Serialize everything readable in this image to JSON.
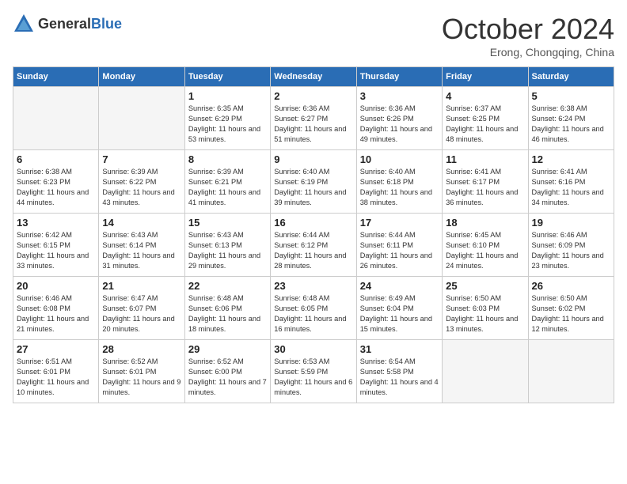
{
  "header": {
    "logo_general": "General",
    "logo_blue": "Blue",
    "month": "October 2024",
    "location": "Erong, Chongqing, China"
  },
  "weekdays": [
    "Sunday",
    "Monday",
    "Tuesday",
    "Wednesday",
    "Thursday",
    "Friday",
    "Saturday"
  ],
  "weeks": [
    [
      {
        "day": "",
        "sunrise": "",
        "sunset": "",
        "daylight": "",
        "empty": true
      },
      {
        "day": "",
        "sunrise": "",
        "sunset": "",
        "daylight": "",
        "empty": true
      },
      {
        "day": "1",
        "sunrise": "Sunrise: 6:35 AM",
        "sunset": "Sunset: 6:29 PM",
        "daylight": "Daylight: 11 hours and 53 minutes."
      },
      {
        "day": "2",
        "sunrise": "Sunrise: 6:36 AM",
        "sunset": "Sunset: 6:27 PM",
        "daylight": "Daylight: 11 hours and 51 minutes."
      },
      {
        "day": "3",
        "sunrise": "Sunrise: 6:36 AM",
        "sunset": "Sunset: 6:26 PM",
        "daylight": "Daylight: 11 hours and 49 minutes."
      },
      {
        "day": "4",
        "sunrise": "Sunrise: 6:37 AM",
        "sunset": "Sunset: 6:25 PM",
        "daylight": "Daylight: 11 hours and 48 minutes."
      },
      {
        "day": "5",
        "sunrise": "Sunrise: 6:38 AM",
        "sunset": "Sunset: 6:24 PM",
        "daylight": "Daylight: 11 hours and 46 minutes."
      }
    ],
    [
      {
        "day": "6",
        "sunrise": "Sunrise: 6:38 AM",
        "sunset": "Sunset: 6:23 PM",
        "daylight": "Daylight: 11 hours and 44 minutes."
      },
      {
        "day": "7",
        "sunrise": "Sunrise: 6:39 AM",
        "sunset": "Sunset: 6:22 PM",
        "daylight": "Daylight: 11 hours and 43 minutes."
      },
      {
        "day": "8",
        "sunrise": "Sunrise: 6:39 AM",
        "sunset": "Sunset: 6:21 PM",
        "daylight": "Daylight: 11 hours and 41 minutes."
      },
      {
        "day": "9",
        "sunrise": "Sunrise: 6:40 AM",
        "sunset": "Sunset: 6:19 PM",
        "daylight": "Daylight: 11 hours and 39 minutes."
      },
      {
        "day": "10",
        "sunrise": "Sunrise: 6:40 AM",
        "sunset": "Sunset: 6:18 PM",
        "daylight": "Daylight: 11 hours and 38 minutes."
      },
      {
        "day": "11",
        "sunrise": "Sunrise: 6:41 AM",
        "sunset": "Sunset: 6:17 PM",
        "daylight": "Daylight: 11 hours and 36 minutes."
      },
      {
        "day": "12",
        "sunrise": "Sunrise: 6:41 AM",
        "sunset": "Sunset: 6:16 PM",
        "daylight": "Daylight: 11 hours and 34 minutes."
      }
    ],
    [
      {
        "day": "13",
        "sunrise": "Sunrise: 6:42 AM",
        "sunset": "Sunset: 6:15 PM",
        "daylight": "Daylight: 11 hours and 33 minutes."
      },
      {
        "day": "14",
        "sunrise": "Sunrise: 6:43 AM",
        "sunset": "Sunset: 6:14 PM",
        "daylight": "Daylight: 11 hours and 31 minutes."
      },
      {
        "day": "15",
        "sunrise": "Sunrise: 6:43 AM",
        "sunset": "Sunset: 6:13 PM",
        "daylight": "Daylight: 11 hours and 29 minutes."
      },
      {
        "day": "16",
        "sunrise": "Sunrise: 6:44 AM",
        "sunset": "Sunset: 6:12 PM",
        "daylight": "Daylight: 11 hours and 28 minutes."
      },
      {
        "day": "17",
        "sunrise": "Sunrise: 6:44 AM",
        "sunset": "Sunset: 6:11 PM",
        "daylight": "Daylight: 11 hours and 26 minutes."
      },
      {
        "day": "18",
        "sunrise": "Sunrise: 6:45 AM",
        "sunset": "Sunset: 6:10 PM",
        "daylight": "Daylight: 11 hours and 24 minutes."
      },
      {
        "day": "19",
        "sunrise": "Sunrise: 6:46 AM",
        "sunset": "Sunset: 6:09 PM",
        "daylight": "Daylight: 11 hours and 23 minutes."
      }
    ],
    [
      {
        "day": "20",
        "sunrise": "Sunrise: 6:46 AM",
        "sunset": "Sunset: 6:08 PM",
        "daylight": "Daylight: 11 hours and 21 minutes."
      },
      {
        "day": "21",
        "sunrise": "Sunrise: 6:47 AM",
        "sunset": "Sunset: 6:07 PM",
        "daylight": "Daylight: 11 hours and 20 minutes."
      },
      {
        "day": "22",
        "sunrise": "Sunrise: 6:48 AM",
        "sunset": "Sunset: 6:06 PM",
        "daylight": "Daylight: 11 hours and 18 minutes."
      },
      {
        "day": "23",
        "sunrise": "Sunrise: 6:48 AM",
        "sunset": "Sunset: 6:05 PM",
        "daylight": "Daylight: 11 hours and 16 minutes."
      },
      {
        "day": "24",
        "sunrise": "Sunrise: 6:49 AM",
        "sunset": "Sunset: 6:04 PM",
        "daylight": "Daylight: 11 hours and 15 minutes."
      },
      {
        "day": "25",
        "sunrise": "Sunrise: 6:50 AM",
        "sunset": "Sunset: 6:03 PM",
        "daylight": "Daylight: 11 hours and 13 minutes."
      },
      {
        "day": "26",
        "sunrise": "Sunrise: 6:50 AM",
        "sunset": "Sunset: 6:02 PM",
        "daylight": "Daylight: 11 hours and 12 minutes."
      }
    ],
    [
      {
        "day": "27",
        "sunrise": "Sunrise: 6:51 AM",
        "sunset": "Sunset: 6:01 PM",
        "daylight": "Daylight: 11 hours and 10 minutes."
      },
      {
        "day": "28",
        "sunrise": "Sunrise: 6:52 AM",
        "sunset": "Sunset: 6:01 PM",
        "daylight": "Daylight: 11 hours and 9 minutes."
      },
      {
        "day": "29",
        "sunrise": "Sunrise: 6:52 AM",
        "sunset": "Sunset: 6:00 PM",
        "daylight": "Daylight: 11 hours and 7 minutes."
      },
      {
        "day": "30",
        "sunrise": "Sunrise: 6:53 AM",
        "sunset": "Sunset: 5:59 PM",
        "daylight": "Daylight: 11 hours and 6 minutes."
      },
      {
        "day": "31",
        "sunrise": "Sunrise: 6:54 AM",
        "sunset": "Sunset: 5:58 PM",
        "daylight": "Daylight: 11 hours and 4 minutes."
      },
      {
        "day": "",
        "sunrise": "",
        "sunset": "",
        "daylight": "",
        "empty": true
      },
      {
        "day": "",
        "sunrise": "",
        "sunset": "",
        "daylight": "",
        "empty": true
      }
    ]
  ]
}
